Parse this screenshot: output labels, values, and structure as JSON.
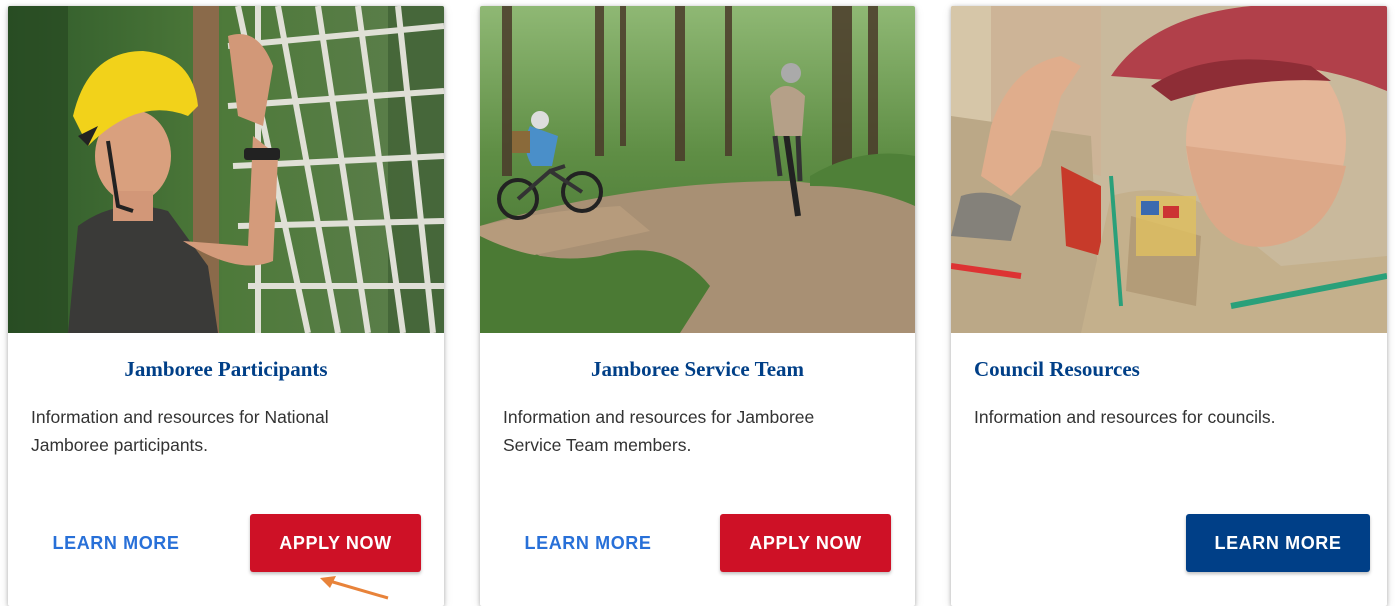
{
  "cards": [
    {
      "title": "Jamboree Participants",
      "description": "Information and resources for National Jamboree participants.",
      "learn_more": "LEARN MORE",
      "apply_now": "APPLY NOW",
      "image": "scout-rope-climbing-photo"
    },
    {
      "title": "Jamboree Service Team",
      "description": "Information and resources for Jamboree Service Team members.",
      "learn_more": "LEARN MORE",
      "apply_now": "APPLY NOW",
      "image": "mountain-biking-trail-photo"
    },
    {
      "title": "Council Resources",
      "description": "Information and resources for councils.",
      "learn_more": "LEARN MORE",
      "image": "scout-saluting-photo"
    }
  ],
  "colors": {
    "title": "#003f87",
    "link": "#2870d8",
    "apply": "#ce1126",
    "navy": "#003f87",
    "annotation": "#e8833a"
  },
  "annotation": "orange-arrow"
}
